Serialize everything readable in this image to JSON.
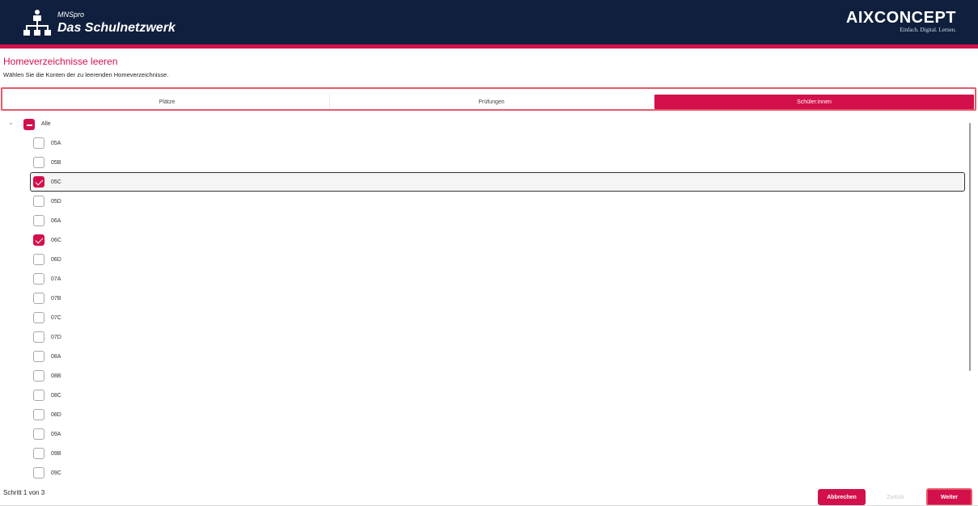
{
  "header": {
    "product_small": "MNSpro",
    "product_name": "Das Schulnetzwerk",
    "vendor_logo": "AIXCONCEPT",
    "vendor_tagline": "Einfach. Digital. Lernen.",
    "logo_icon": "network-tree-icon",
    "colors": {
      "header_bg": "#0f1f3d",
      "accent": "#d3104c"
    }
  },
  "page": {
    "title": "Homeverzeichnisse leeren",
    "subtitle": "Wählen Sie die Konten der zu leerenden Homeverzeichnisse."
  },
  "tabs": [
    {
      "label": "Plätze",
      "active": false
    },
    {
      "label": "Prüfungen",
      "active": false
    },
    {
      "label": "Schüler:innen",
      "active": true
    }
  ],
  "tree": {
    "root": {
      "label": "Alle",
      "state": "partial",
      "expanded": true
    },
    "items": [
      {
        "label": "05A",
        "checked": false
      },
      {
        "label": "05B",
        "checked": false
      },
      {
        "label": "05C",
        "checked": true,
        "selected": true
      },
      {
        "label": "05D",
        "checked": false
      },
      {
        "label": "06A",
        "checked": false
      },
      {
        "label": "06C",
        "checked": true
      },
      {
        "label": "06D",
        "checked": false
      },
      {
        "label": "07A",
        "checked": false
      },
      {
        "label": "07B",
        "checked": false
      },
      {
        "label": "07C",
        "checked": false
      },
      {
        "label": "07D",
        "checked": false
      },
      {
        "label": "08A",
        "checked": false
      },
      {
        "label": "08B",
        "checked": false
      },
      {
        "label": "08C",
        "checked": false
      },
      {
        "label": "08D",
        "checked": false
      },
      {
        "label": "09A",
        "checked": false
      },
      {
        "label": "09B",
        "checked": false
      },
      {
        "label": "09C",
        "checked": false
      }
    ]
  },
  "footer": {
    "step_text": "Schritt 1 von 3",
    "cancel_label": "Abbrechen",
    "back_label": "Zurück",
    "next_label": "Weiter"
  }
}
